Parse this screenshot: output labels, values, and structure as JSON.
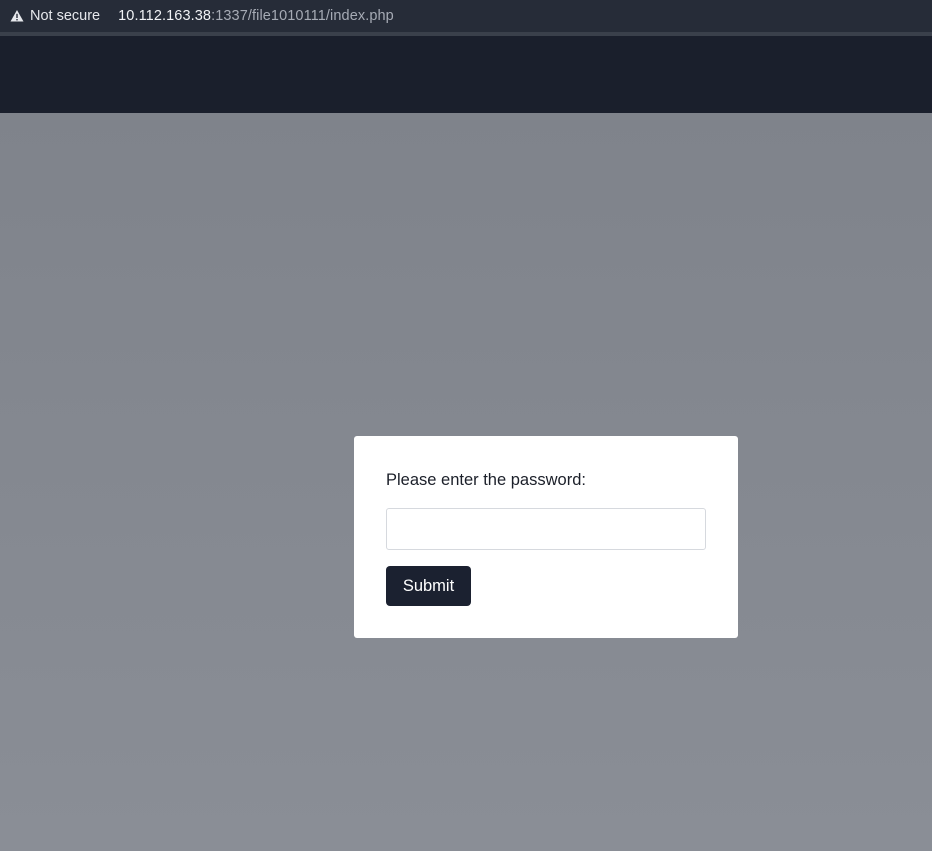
{
  "browser": {
    "security_label": "Not secure",
    "url_host": "10.112.163.38",
    "url_rest": ":1337/file1010111/index.php",
    "security_icon": "warning-triangle-icon"
  },
  "modal": {
    "prompt": "Please enter the password:",
    "password_value": "",
    "password_placeholder": "",
    "submit_label": "Submit"
  },
  "colors": {
    "header": "#1a1f2c",
    "overlay": "#868a93",
    "button": "#1b2130"
  }
}
